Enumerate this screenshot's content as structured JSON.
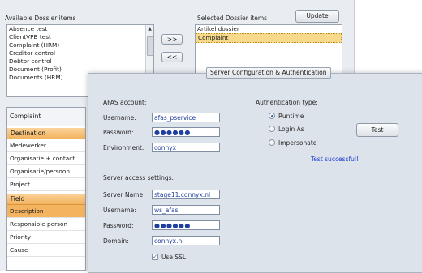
{
  "dossier": {
    "available_label": "Available Dossier items",
    "selected_label": "Selected Dossier items",
    "update_button": "Update",
    "add_button": ">>",
    "remove_button": "<<",
    "available_items": [
      "Absence test",
      "ClientVPB test",
      "Complaint (HRM)",
      "Creditor control",
      "Debtor control",
      "Document (Profit)",
      "Documents (HRM)"
    ],
    "selected_items": [
      "Artikel dossier",
      "Complaint"
    ],
    "selected_index": 1
  },
  "complaint_panel": {
    "title": "Complaint",
    "destination_header": "Destination",
    "destination_rows": [
      "Medewerker",
      "Organisatie + contact",
      "Organisatie/persoon",
      "Project"
    ],
    "field_header": "Field",
    "field_rows": [
      "Description",
      "Responsible person",
      "Priority",
      "Cause"
    ],
    "field_selected_index": 0
  },
  "dialog": {
    "title": "Server Configuration & Authentication",
    "afas_account_label": "AFAS account:",
    "username_label": "Username:",
    "username_value": "afas_pservice",
    "password_label": "Password:",
    "password_value": "●●●●●●",
    "environment_label": "Environment:",
    "environment_value": "connyx",
    "auth_type_label": "Authentication type:",
    "auth_options": [
      "Runtime",
      "Login As",
      "Impersonate"
    ],
    "auth_selected_index": 0,
    "test_button": "Test",
    "test_result": "Test successful!",
    "server_access_label": "Server access settings:",
    "server_name_label": "Server Name:",
    "server_name_value": "stage11.connyx.nl",
    "server_username_label": "Username:",
    "server_username_value": "ws_afas",
    "server_password_label": "Password:",
    "server_password_value": "●●●●●●",
    "domain_label": "Domain:",
    "domain_value": "connyx.nl",
    "use_ssl_label": "Use SSL",
    "use_ssl_checked": true
  }
}
